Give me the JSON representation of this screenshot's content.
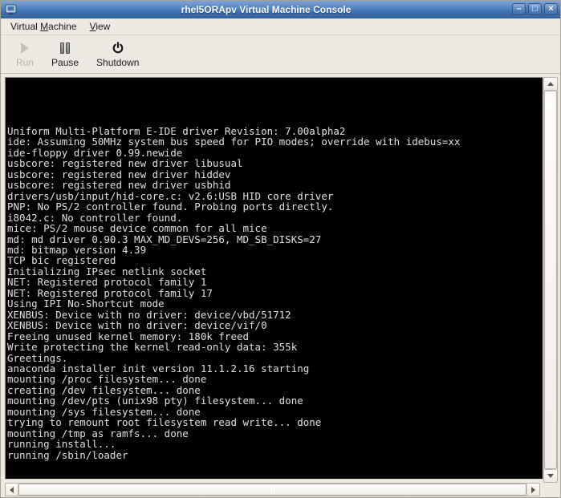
{
  "window": {
    "title": "rhel5ORApv Virtual Machine Console",
    "controls": [
      {
        "name": "minimize",
        "glyph": "–"
      },
      {
        "name": "maximize",
        "glyph": "□"
      },
      {
        "name": "close",
        "glyph": "×"
      }
    ]
  },
  "menubar": {
    "items": [
      {
        "pre": "Virtual ",
        "key": "M",
        "post": "achine"
      },
      {
        "pre": "",
        "key": "V",
        "post": "iew"
      }
    ]
  },
  "toolbar": {
    "buttons": [
      {
        "label": "Run",
        "icon": "play-icon",
        "enabled": false
      },
      {
        "label": "Pause",
        "icon": "pause-icon",
        "enabled": true
      },
      {
        "label": "Shutdown",
        "icon": "power-icon",
        "enabled": true
      }
    ]
  },
  "console": {
    "lines": [
      "Uniform Multi-Platform E-IDE driver Revision: 7.00alpha2",
      "ide: Assuming 50MHz system bus speed for PIO modes; override with idebus=xx",
      "ide-floppy driver 0.99.newide",
      "usbcore: registered new driver libusual",
      "usbcore: registered new driver hiddev",
      "usbcore: registered new driver usbhid",
      "drivers/usb/input/hid-core.c: v2.6:USB HID core driver",
      "PNP: No PS/2 controller found. Probing ports directly.",
      "i8042.c: No controller found.",
      "mice: PS/2 mouse device common for all mice",
      "md: md driver 0.90.3 MAX_MD_DEVS=256, MD_SB_DISKS=27",
      "md: bitmap version 4.39",
      "TCP bic registered",
      "Initializing IPsec netlink socket",
      "NET: Registered protocol family 1",
      "NET: Registered protocol family 17",
      "Using IPI No-Shortcut mode",
      "XENBUS: Device with no driver: device/vbd/51712",
      "XENBUS: Device with no driver: device/vif/0",
      "Freeing unused kernel memory: 180k freed",
      "Write protecting the kernel read-only data: 355k",
      "Greetings.",
      "anaconda installer init version 11.1.2.16 starting",
      "mounting /proc filesystem... done",
      "creating /dev filesystem... done",
      "mounting /dev/pts (unix98 pty) filesystem... done",
      "mounting /sys filesystem... done",
      "trying to remount root filesystem read write... done",
      "mounting /tmp as ramfs... done",
      "running install...",
      "running /sbin/loader"
    ]
  },
  "colors": {
    "titlebar_blue": "#3465a4",
    "window_bg": "#ede9e3",
    "terminal_bg": "#000000",
    "terminal_fg": "#e0e0e0"
  }
}
